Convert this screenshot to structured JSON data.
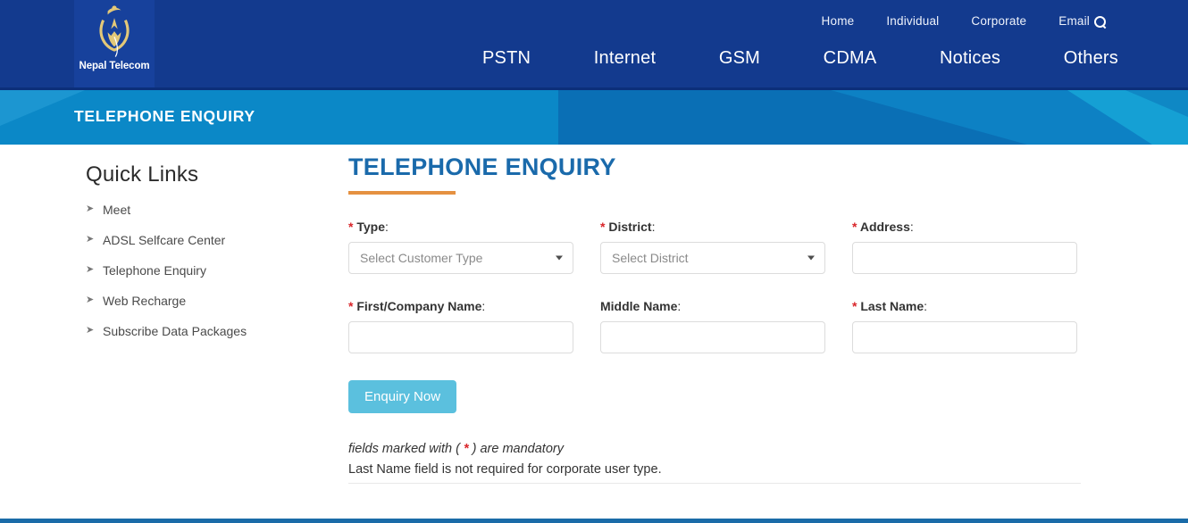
{
  "brand": {
    "name": "Nepal Telecom",
    "logo_icon": "nepal-telecom-logo"
  },
  "header": {
    "top_nav": [
      {
        "label": "Home"
      },
      {
        "label": "Individual"
      },
      {
        "label": "Corporate"
      },
      {
        "label": "Email"
      }
    ],
    "search_icon": "search-icon",
    "main_nav": [
      {
        "label": "PSTN"
      },
      {
        "label": "Internet"
      },
      {
        "label": "GSM"
      },
      {
        "label": "CDMA"
      },
      {
        "label": "Notices"
      },
      {
        "label": "Others"
      }
    ]
  },
  "banner": {
    "title": "TELEPHONE ENQUIRY"
  },
  "sidebar": {
    "title": "Quick Links",
    "bullet_icon": "chevron-right-icon",
    "items": [
      {
        "label": "Meet"
      },
      {
        "label": "ADSL Selfcare Center"
      },
      {
        "label": "Telephone Enquiry"
      },
      {
        "label": "Web Recharge"
      },
      {
        "label": "Subscribe Data Packages"
      }
    ]
  },
  "main": {
    "title": "TELEPHONE ENQUIRY",
    "form": {
      "row1": [
        {
          "key": "type",
          "label": "Type",
          "required": true,
          "control": "select",
          "value": "Select Customer Type",
          "caret_icon": "chevron-down-icon"
        },
        {
          "key": "district",
          "label": "District",
          "required": true,
          "control": "select",
          "value": "Select District",
          "caret_icon": "chevron-down-icon"
        },
        {
          "key": "address",
          "label": "Address",
          "required": true,
          "control": "text",
          "value": "",
          "placeholder": ""
        }
      ],
      "row2": [
        {
          "key": "first_company_name",
          "label": "First/Company Name",
          "required": true,
          "control": "text",
          "value": "",
          "placeholder": ""
        },
        {
          "key": "middle_name",
          "label": "Middle Name",
          "required": false,
          "control": "text",
          "value": "",
          "placeholder": ""
        },
        {
          "key": "last_name",
          "label": "Last Name",
          "required": true,
          "control": "text",
          "value": "",
          "placeholder": ""
        }
      ],
      "submit_label": "Enquiry Now",
      "required_marker": "*",
      "label_separator": ":"
    },
    "notes": {
      "mandatory_prefix": "fields marked with ( ",
      "mandatory_star": "*",
      "mandatory_suffix": " ) are mandatory",
      "corporate": "Last Name field is not required for corporate user type."
    }
  },
  "colors": {
    "header_blue": "#133a8e",
    "banner_blue": "#0b88c7",
    "title_blue": "#1a6aab",
    "accent_orange": "#e59141",
    "button_blue": "#5bc0de",
    "required_red": "#d9252a",
    "footer_blue": "#1a6ba8"
  }
}
